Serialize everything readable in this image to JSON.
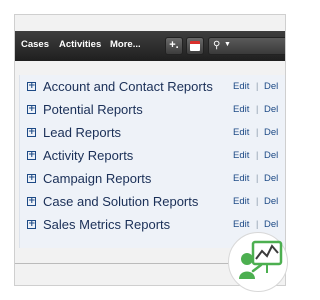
{
  "nav": {
    "items": [
      "Cases",
      "Activities",
      "More..."
    ],
    "add_label": "+."
  },
  "reports": [
    {
      "label": "Account and Contact Reports",
      "edit": "Edit",
      "del": "Del"
    },
    {
      "label": "Potential Reports",
      "edit": "Edit",
      "del": "Del"
    },
    {
      "label": "Lead Reports",
      "edit": "Edit",
      "del": "Del"
    },
    {
      "label": "Activity Reports",
      "edit": "Edit",
      "del": "Del"
    },
    {
      "label": "Campaign Reports",
      "edit": "Edit",
      "del": "Del"
    },
    {
      "label": "Case and Solution Reports",
      "edit": "Edit",
      "del": "Del"
    },
    {
      "label": "Sales Metrics Reports",
      "edit": "Edit",
      "del": "Del"
    }
  ],
  "colors": {
    "nav_bg": "#2b2b2b",
    "link": "#1d4a86",
    "panel_bg": "#eef2f8",
    "badge_green": "#4caf50"
  },
  "icons": {
    "expand": "plus-square-icon",
    "calendar": "calendar-icon",
    "search": "search-icon",
    "badge": "presenter-chart-icon"
  }
}
